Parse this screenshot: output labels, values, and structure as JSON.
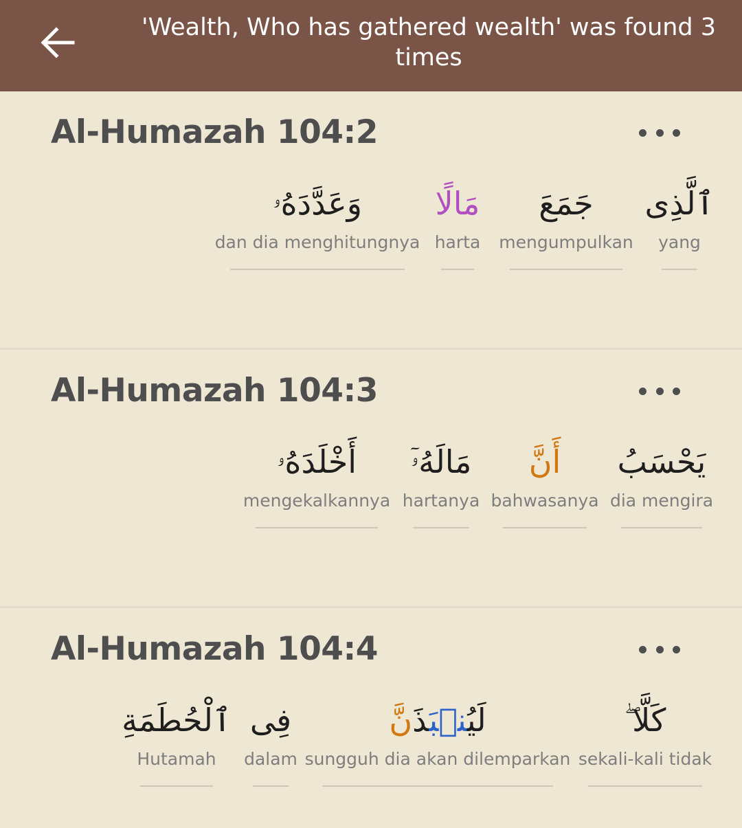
{
  "header": {
    "back_icon": "arrow-left-icon",
    "title": "'Wealth, Who has gathered wealth' was found 3 times"
  },
  "verses": [
    {
      "ref": "Al-Humazah 104:2",
      "more_icon": "more-horizontal-icon",
      "words": [
        {
          "arabic": "ٱلَّذِى",
          "gloss": "yang"
        },
        {
          "arabic": "جَمَعَ",
          "gloss": "mengumpulkan"
        },
        {
          "arabic": "مَالًا",
          "gloss": "harta"
        },
        {
          "arabic": "وَعَدَّدَهُۥ",
          "gloss": "dan dia menghitungnya"
        }
      ]
    },
    {
      "ref": "Al-Humazah 104:3",
      "more_icon": "more-horizontal-icon",
      "words": [
        {
          "arabic": "يَحْسَبُ",
          "gloss": "dia mengira"
        },
        {
          "arabic": "أَنَّ",
          "gloss": "bahwasanya"
        },
        {
          "arabic": "مَالَهُۥٓ",
          "gloss": "hartanya"
        },
        {
          "arabic": "أَخْلَدَهُۥ",
          "gloss": "mengekalkannya"
        }
      ]
    },
    {
      "ref": "Al-Humazah 104:4",
      "more_icon": "more-horizontal-icon",
      "words": [
        {
          "arabic": "كَلَّا ۖ",
          "gloss": "sekali-kali tidak"
        },
        {
          "arabic": "لَيُنۢبَذَنَّ",
          "gloss": "sungguh dia akan dilemparkan"
        },
        {
          "arabic": "فِى",
          "gloss": "dalam"
        },
        {
          "arabic": "ٱلْحُطَمَةِ",
          "gloss": "Hutamah"
        }
      ]
    }
  ],
  "colors": {
    "header_bg": "#7A5446",
    "page_bg": "#EEE7D4",
    "highlight_purple": "#B14FC1",
    "highlight_orange": "#D27811",
    "highlight_blue": "#2D63C8"
  }
}
